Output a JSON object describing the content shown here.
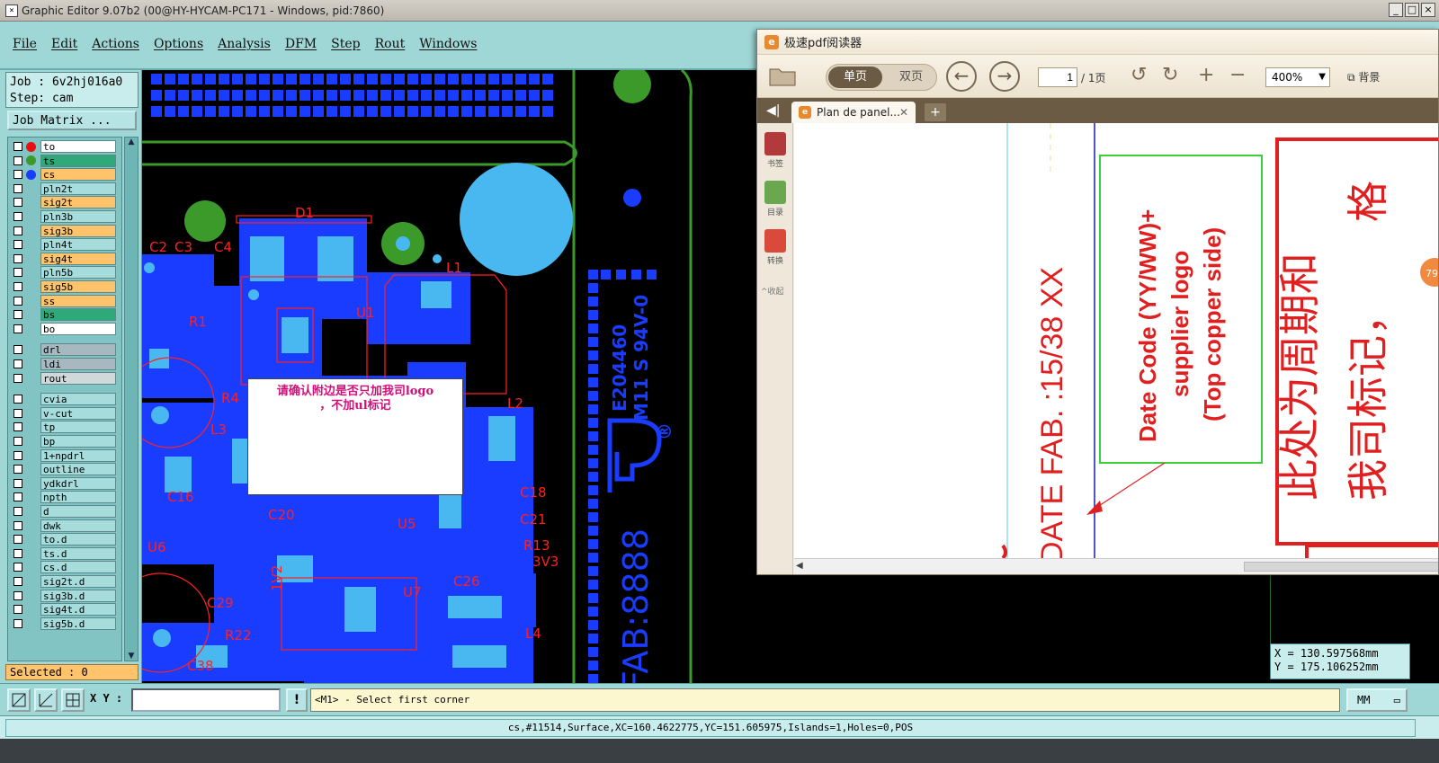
{
  "window": {
    "title": "Graphic Editor 9.07b2 (00@HY-HYCAM-PC171 - Windows, pid:7860)",
    "min": "_",
    "max": "□",
    "close": "×"
  },
  "menu": [
    "File",
    "Edit",
    "Actions",
    "Options",
    "Analysis",
    "DFM",
    "Step",
    "Rout",
    "Windows"
  ],
  "job": {
    "line1": "Job : 6v2hj016a0",
    "line2": "Step: cam",
    "matrix_button": "Job Matrix ..."
  },
  "layers": [
    {
      "name": "to",
      "bg": "#ffffff",
      "dot": "#e81010"
    },
    {
      "name": "ts",
      "bg": "#2fa87a",
      "dot": "#3b9a2a"
    },
    {
      "name": "cs",
      "bg": "#ffc36b",
      "dot": "#1a3cff"
    },
    {
      "name": "pln2t",
      "bg": "#a6dcdc"
    },
    {
      "name": "sig2t",
      "bg": "#ffc36b"
    },
    {
      "name": "pln3b",
      "bg": "#a6dcdc"
    },
    {
      "name": "sig3b",
      "bg": "#ffc36b"
    },
    {
      "name": "pln4t",
      "bg": "#a6dcdc"
    },
    {
      "name": "sig4t",
      "bg": "#ffc36b"
    },
    {
      "name": "pln5b",
      "bg": "#a6dcdc"
    },
    {
      "name": "sig5b",
      "bg": "#ffc36b"
    },
    {
      "name": "ss",
      "bg": "#ffc36b"
    },
    {
      "name": "bs",
      "bg": "#2fa87a"
    },
    {
      "name": "bo",
      "bg": "#ffffff"
    },
    {
      "name": "drl",
      "bg": "#a8b8c0"
    },
    {
      "name": "ldi",
      "bg": "#a8b8c0"
    },
    {
      "name": "rout",
      "bg": "#d0d8d8"
    },
    {
      "name": "cvia",
      "bg": "#a6dcdc"
    },
    {
      "name": "v-cut",
      "bg": "#a6dcdc"
    },
    {
      "name": "tp",
      "bg": "#a6dcdc"
    },
    {
      "name": "bp",
      "bg": "#a6dcdc"
    },
    {
      "name": "1+npdrl",
      "bg": "#a6dcdc"
    },
    {
      "name": "outline",
      "bg": "#a6dcdc"
    },
    {
      "name": "ydkdrl",
      "bg": "#a6dcdc"
    },
    {
      "name": "npth",
      "bg": "#a6dcdc"
    },
    {
      "name": "d",
      "bg": "#a6dcdc"
    },
    {
      "name": "dwk",
      "bg": "#a6dcdc"
    },
    {
      "name": "to.d",
      "bg": "#a6dcdc"
    },
    {
      "name": "ts.d",
      "bg": "#a6dcdc"
    },
    {
      "name": "cs.d",
      "bg": "#a6dcdc"
    },
    {
      "name": "sig2t.d",
      "bg": "#a6dcdc"
    },
    {
      "name": "sig3b.d",
      "bg": "#a6dcdc"
    },
    {
      "name": "sig4t.d",
      "bg": "#a6dcdc"
    },
    {
      "name": "sig5b.d",
      "bg": "#a6dcdc"
    }
  ],
  "selected": "Selected : 0",
  "canvas": {
    "labels": [
      "D1",
      "C2",
      "C3",
      "C4",
      "L1",
      "R1",
      "U1",
      "R4",
      "L2",
      "L3",
      "C16",
      "C18",
      "C20",
      "C21",
      "U5",
      "U6",
      "R13",
      "3V3",
      "C26",
      "U7",
      "C29",
      "R22",
      "L4",
      "C38",
      "1V2"
    ],
    "silkscreen_vertical": [
      "E204460",
      "M11 S 94V-0"
    ],
    "fab_text": "FAB:8888",
    "ul_mark": "®",
    "note_line1": "请确认附边是否只加我司logo",
    "note_line2": "，不加ul标记"
  },
  "coords": {
    "x": "X = 130.597568mm",
    "y": "Y = 175.106252mm"
  },
  "bottom": {
    "xy_label": "X Y :",
    "xy_value": "",
    "warn": "!",
    "prompt": "<M1> - Select first corner",
    "units": "MM"
  },
  "status": "cs,#11514,Surface,XC=160.4622775,YC=151.605975,Islands=1,Holes=0,POS",
  "pdf": {
    "title": "极速pdf阅读器",
    "single": "单页",
    "double": "双页",
    "page_current": "1",
    "page_total": "/ 1页",
    "zoom": "400%",
    "background": "背景",
    "tab_title": "Plan de panel...",
    "tab_add": "+",
    "side": [
      "书签",
      "目录",
      "转换"
    ],
    "collapse": "^收起",
    "doc": {
      "date_fab": "DATE FAB. :15/38 XX",
      "box_line1": "Date Code (YY/WW)+",
      "box_line2": "supplier logo",
      "box_line3": "(Top copper side)",
      "chinese_line1": "此处为周期和",
      "chinese_line2": "我司标记，",
      "chinese_frag": "格",
      "badge": "79"
    }
  },
  "colors": {
    "panel": "#9fd7d7",
    "copper": "#1a3cff",
    "silk": "#ff2020",
    "highlight": "#4ab8f0",
    "green_pad": "#3b9a2a"
  }
}
